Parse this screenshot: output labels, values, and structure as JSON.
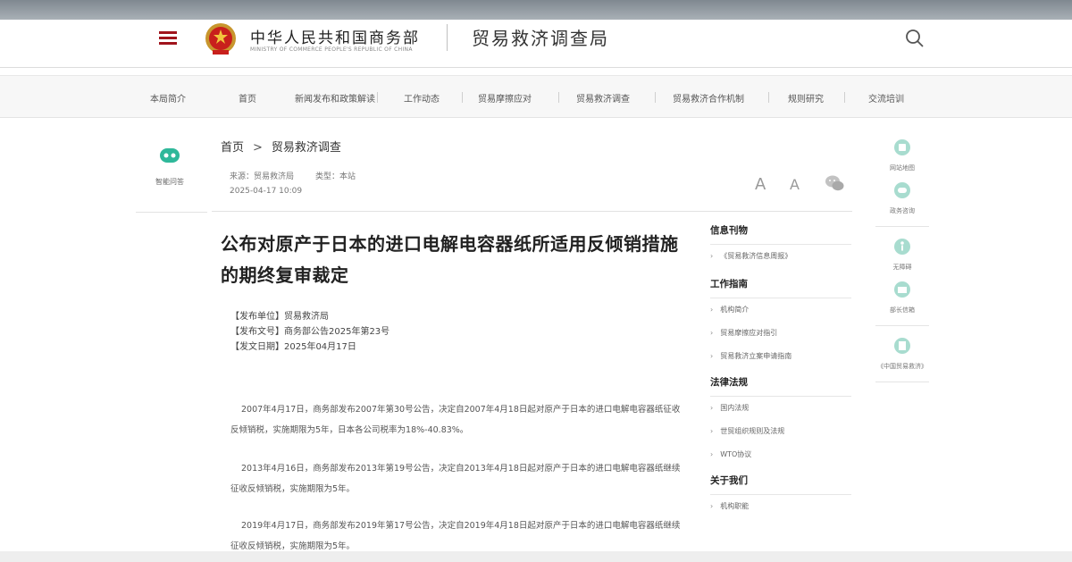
{
  "header": {
    "ministry_cn": "中华人民共和国商务部",
    "ministry_en": "MINISTRY OF COMMERCE PEOPLE'S REPUBLIC OF CHINA",
    "bureau": "贸易救济调查局",
    "icons": [
      "menu-icon",
      "national-emblem",
      "search-icon"
    ]
  },
  "nav": {
    "items": [
      "本局简介",
      "首页",
      "新闻发布和政策解读",
      "工作动态",
      "贸易摩擦应对",
      "贸易救济调查",
      "贸易救济合作机制",
      "规则研究",
      "交流培训"
    ]
  },
  "left_share": {
    "label": "智能问答",
    "icon": "chatbot-icon"
  },
  "breadcrumb": {
    "home": "首页",
    "arrow": ">",
    "current": "贸易救济调查"
  },
  "article": {
    "source": "来源：贸易救济局",
    "category": "类型：本站",
    "date": "2025-04-17 10:09",
    "font_large": "A",
    "font_small": "A",
    "title": "公布对原产于日本的进口电解电容器纸所适用反倾销措施的期终复审裁定",
    "pub_unit": "【发布单位】贸易救济局",
    "pub_doc": "【发布文号】商务部公告2025年第23号",
    "pub_date": "【发文日期】2025年04月17日",
    "paragraphs": [
      "2007年4月17日，商务部发布2007年第30号公告，决定自2007年4月18日起对原产于日本的进口电解电容器纸征收反倾销税，实施期限为5年，日本各公司税率为18%-40.83%。",
      "2013年4月16日，商务部发布2013年第19号公告，决定自2013年4月18日起对原产于日本的进口电解电容器纸继续征收反倾销税，实施期限为5年。",
      "2019年4月17日，商务部发布2019年第17号公告，决定自2019年4月18日起对原产于日本的进口电解电容器纸继续征收反倾销税，实施期限为5年。"
    ]
  },
  "sidebar": {
    "sections": [
      {
        "title": "信息刊物",
        "items": [
          "《贸易救济信息周报》"
        ]
      },
      {
        "title": "工作指南",
        "items": [
          "机构简介",
          "贸易摩擦应对指引",
          "贸易救济立案申请指南"
        ]
      },
      {
        "title": "法律法规",
        "items": [
          "国内法规",
          "世贸组织规则及法规",
          "WTO协议"
        ]
      },
      {
        "title": "关于我们",
        "items": [
          "机构职能"
        ]
      }
    ]
  },
  "right_tools": [
    {
      "label": "网站地图",
      "icon": "sitemap-icon"
    },
    {
      "label": "政务咨询",
      "icon": "consult-icon"
    },
    {
      "label": "无障碍",
      "icon": "accessibility-icon"
    },
    {
      "label": "部长信箱",
      "icon": "mailbox-icon"
    },
    {
      "label": "《中国贸易救济》",
      "icon": "magazine-icon"
    }
  ],
  "colors": {
    "accent": "#a0141c",
    "teal": "#2fb89a",
    "topband": "#8a939a"
  }
}
